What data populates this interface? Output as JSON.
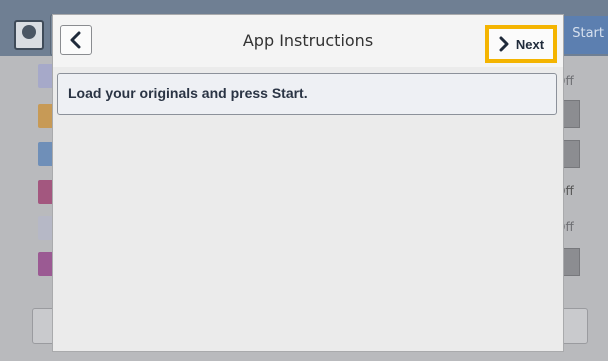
{
  "background": {
    "start_label": "Start",
    "off_labels": [
      "Off",
      "Off",
      "Off"
    ]
  },
  "modal": {
    "title": "App Instructions",
    "next_label": "Next",
    "instructions": "Load your originals and press Start."
  },
  "colors": {
    "next_highlight": "#f4b400",
    "header_background": "#6f7f93",
    "modal_background": "#ebebeb"
  },
  "icons": {
    "back": "chevron-left-icon",
    "next": "chevron-right-icon",
    "user": "user-avatar-icon"
  }
}
